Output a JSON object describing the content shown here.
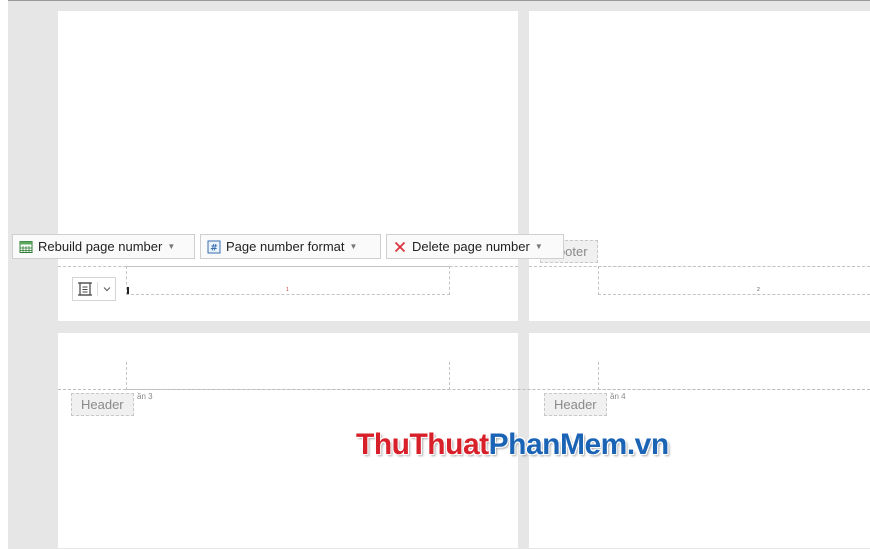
{
  "toolbar": {
    "rebuild_label": "Rebuild page number",
    "format_label": "Page number format",
    "delete_label": "Delete page number"
  },
  "pages": {
    "page1_number": "1",
    "page2_number": "2",
    "footer_tag": "Footer",
    "header3_tag": "Header",
    "header4_tag": "Header",
    "section3_label": "ần 3",
    "section4_label": "ần 4"
  },
  "watermark": {
    "part1": "ThuThuat",
    "part2": "PhanMem.vn"
  },
  "colors": {
    "delete_icon": "#d8323a",
    "watermark_red": "#d8202a",
    "watermark_blue": "#1a63b5"
  }
}
